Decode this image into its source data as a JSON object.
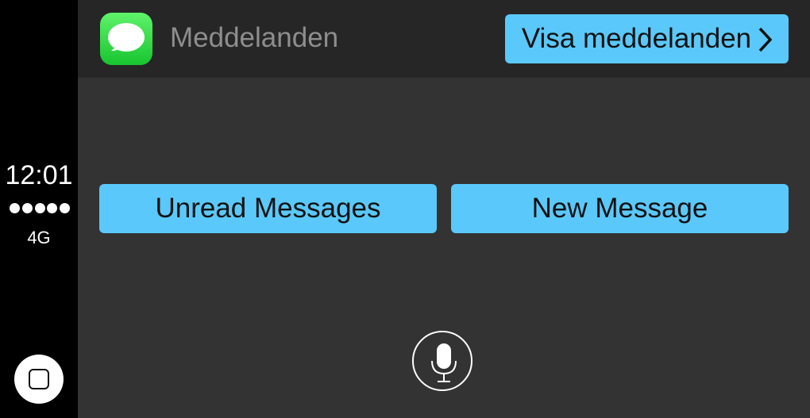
{
  "status": {
    "time": "12:01",
    "signal_bars": 5,
    "network": "4G"
  },
  "header": {
    "app_title": "Meddelanden",
    "show_button_label": "Visa meddelanden"
  },
  "actions": {
    "unread_label": "Unread Messages",
    "new_label": "New Message"
  },
  "icons": {
    "app": "messages-icon",
    "chevron": "chevron-right-icon",
    "home": "home-icon",
    "mic": "microphone-icon"
  },
  "colors": {
    "accent": "#5ac8fa",
    "background": "#333333",
    "header": "#262626",
    "sidebar": "#000000",
    "app_icon_green": "#2bd44a"
  }
}
